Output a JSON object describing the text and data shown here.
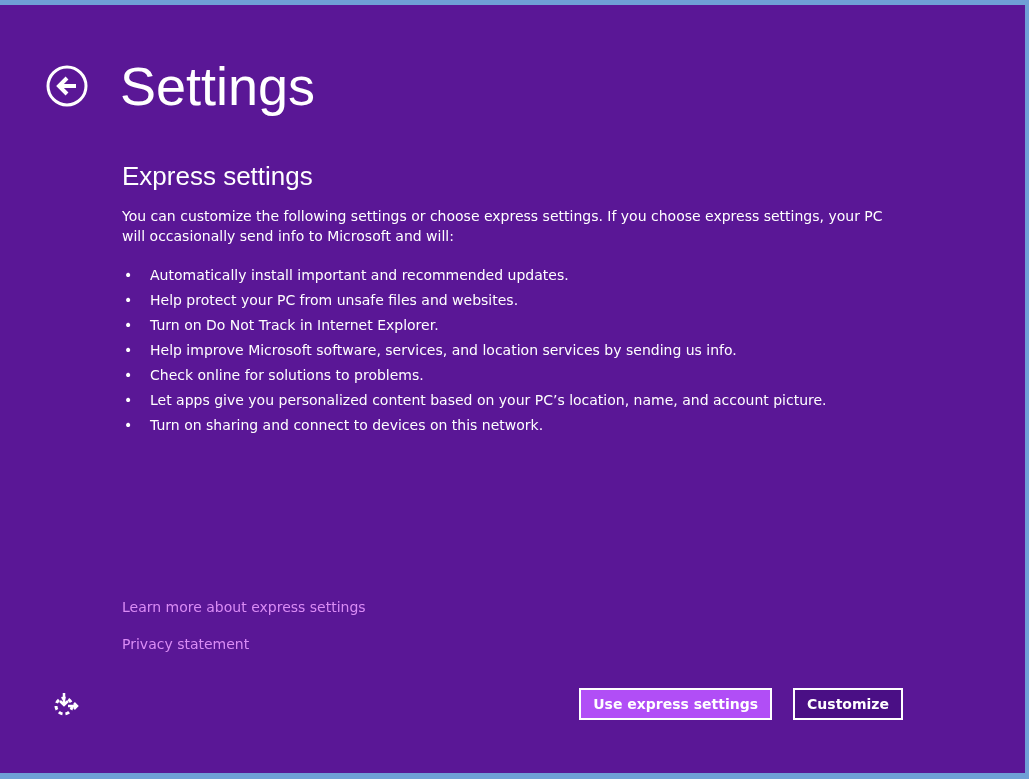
{
  "header": {
    "title": "Settings"
  },
  "section": {
    "heading": "Express settings",
    "intro": "You can customize the following settings or choose express settings. If you choose express settings, your PC will occasionally send info to Microsoft and will:",
    "items": [
      {
        "bullet": "•",
        "text": "Automatically install important and recommended updates."
      },
      {
        "bullet": "•",
        "text": "Help protect your PC from unsafe files and websites."
      },
      {
        "bullet": "•",
        "text": "Turn on Do Not Track in Internet Explorer."
      },
      {
        "bullet": "•",
        "text": "Help improve Microsoft software, services, and location services by sending us info."
      },
      {
        "bullet": "•",
        "text": "Check online for solutions to problems."
      },
      {
        "bullet": "•",
        "text": "Let apps give you personalized content based on your PC’s location, name, and account picture."
      },
      {
        "bullet": "•",
        "text": "Turn on sharing and connect to devices on this network."
      }
    ]
  },
  "links": [
    "Learn more about express settings",
    "Privacy statement"
  ],
  "buttons": [
    {
      "label": "Use express settings",
      "kind": "primary"
    },
    {
      "label": "Customize",
      "kind": "secondary"
    }
  ]
}
